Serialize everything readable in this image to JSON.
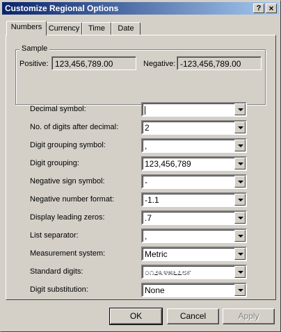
{
  "window": {
    "title": "Customize Regional Options",
    "help_label": "?",
    "close_label": "×"
  },
  "tabs": [
    {
      "label": "Numbers",
      "active": true
    },
    {
      "label": "Currency",
      "active": false
    },
    {
      "label": "Time",
      "active": false
    },
    {
      "label": "Date",
      "active": false
    }
  ],
  "sample": {
    "title": "Sample",
    "positive_label": "Positive:",
    "positive_value": "123,456,789.00",
    "negative_label": "Negative:",
    "negative_value": "-123,456,789.00"
  },
  "settings": [
    {
      "label": "Decimal symbol:",
      "value": ""
    },
    {
      "label": "No. of digits after decimal:",
      "value": "2"
    },
    {
      "label": "Digit grouping symbol:",
      "value": ","
    },
    {
      "label": "Digit grouping:",
      "value": "123,456,789"
    },
    {
      "label": "Negative sign symbol:",
      "value": "-"
    },
    {
      "label": "Negative number format:",
      "value": "-1.1"
    },
    {
      "label": "Display leading zeros:",
      "value": ".7"
    },
    {
      "label": "List separator:",
      "value": ","
    },
    {
      "label": "Measurement system:",
      "value": "Metric"
    },
    {
      "label": "Standard digits:",
      "value": "೦೧೨೩೪೫೬೭೮೯"
    },
    {
      "label": "Digit substitution:",
      "value": "None"
    }
  ],
  "buttons": {
    "ok": "OK",
    "cancel": "Cancel",
    "apply": "Apply"
  }
}
